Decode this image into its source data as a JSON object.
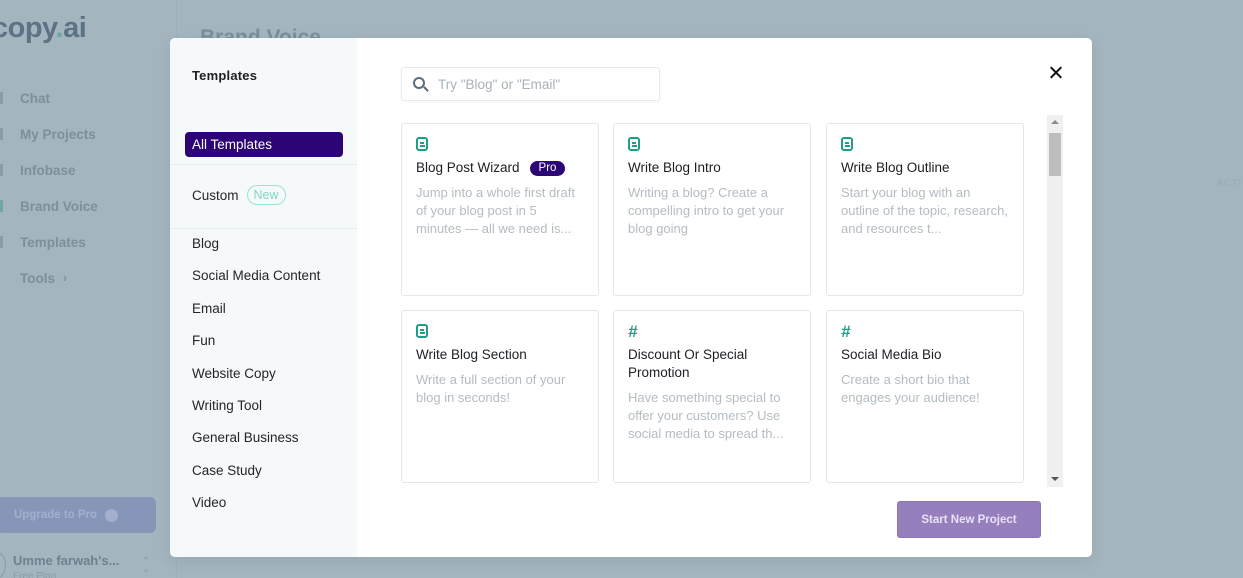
{
  "background": {
    "logo": {
      "main": "copy",
      "dot": ".",
      "suffix": "ai"
    },
    "page_heading": "Brand Voice",
    "nav": [
      {
        "label": "Chat"
      },
      {
        "label": "My Projects"
      },
      {
        "label": "Infobase"
      },
      {
        "label": "Brand Voice"
      },
      {
        "label": "Templates"
      },
      {
        "label": "Tools",
        "chevron": "›"
      }
    ],
    "upgrade_label": "Upgrade to Pro",
    "user_name": "Umme farwah's...",
    "user_plan": "Free Plan",
    "right_label": "ACTI"
  },
  "modal": {
    "sidebar": {
      "title": "Templates",
      "all_templates": "All Templates",
      "custom": {
        "label": "Custom",
        "badge": "New"
      },
      "categories": [
        "Blog",
        "Social Media Content",
        "Email",
        "Fun",
        "Website Copy",
        "Writing Tool",
        "General Business",
        "Case Study",
        "Video"
      ]
    },
    "search": {
      "placeholder": "Try \"Blog\" or \"Email\"",
      "value": ""
    },
    "cards": [
      {
        "icon": "document-icon",
        "title": "Blog Post Wizard",
        "badge": "Pro",
        "description": "Jump into a whole first draft of your blog post in 5 minutes — all we need is..."
      },
      {
        "icon": "document-icon",
        "title": "Write Blog Intro",
        "description": "Writing a blog? Create a compelling intro to get your blog going"
      },
      {
        "icon": "document-icon",
        "title": "Write Blog Outline",
        "description": "Start your blog with an outline of the topic, research, and resources t..."
      },
      {
        "icon": "document-icon",
        "title": "Write Blog Section",
        "description": "Write a full section of your blog in seconds!"
      },
      {
        "icon": "hashtag-icon",
        "title": "Discount Or Special Promotion",
        "description": "Have something special to offer your customers? Use social media to spread th..."
      },
      {
        "icon": "hashtag-icon",
        "title": "Social Media Bio",
        "description": "Create a short bio that engages your audience!"
      }
    ],
    "start_button": "Start New Project",
    "colors": {
      "accent": "#2c0475",
      "teal": "#1e9e8a",
      "button": "#9580bd"
    }
  }
}
